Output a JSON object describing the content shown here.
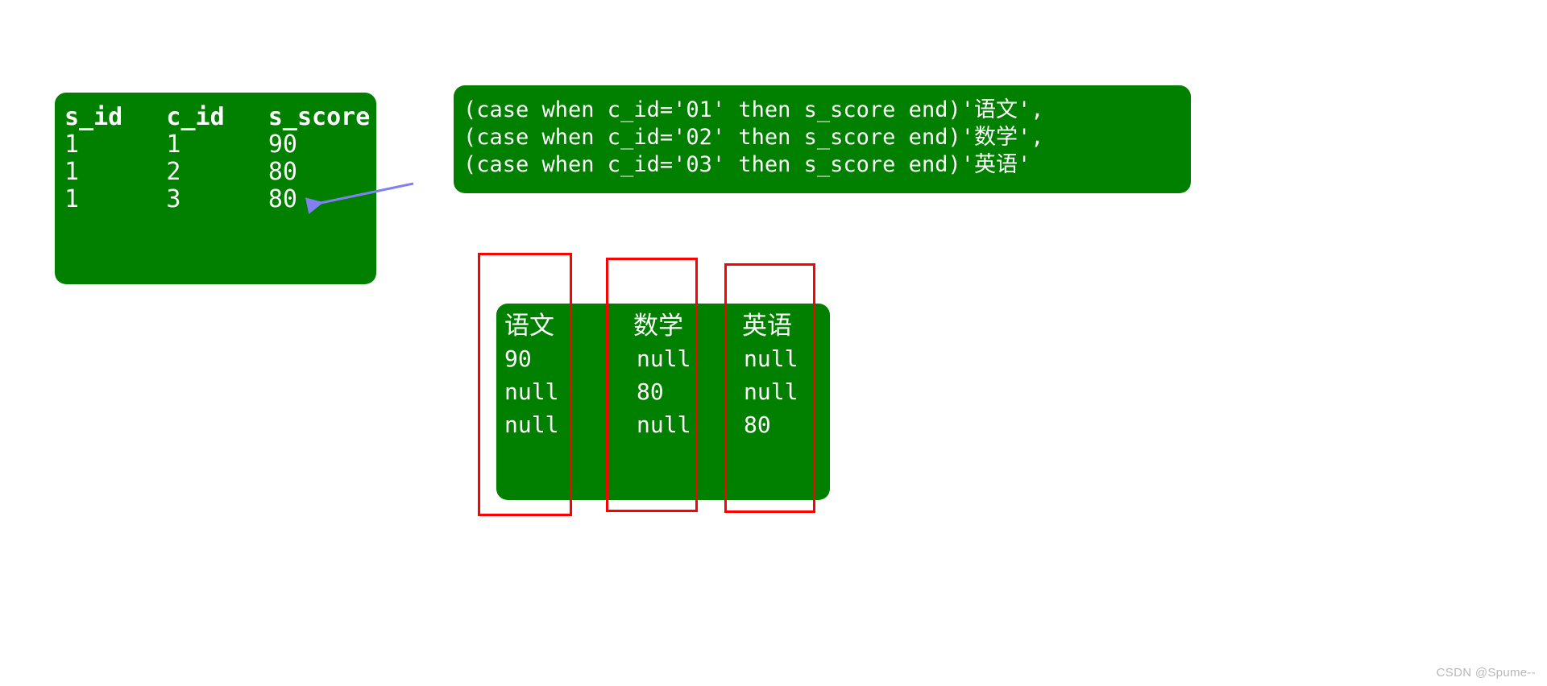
{
  "source_table": {
    "header": "s_id   c_id   s_score",
    "rows": [
      "1      1      90",
      "1      2      80",
      "1      3      80"
    ]
  },
  "sql_block": {
    "lines": [
      "(case when c_id='01' then s_score end)'语文',",
      "(case when c_id='02' then s_score end)'数学',",
      "(case when c_id='03' then s_score end)'英语'"
    ]
  },
  "result_table": {
    "columns": [
      {
        "header": "语文",
        "cells": [
          "90",
          "null",
          "null"
        ]
      },
      {
        "header": "数学",
        "cells": [
          "null",
          "80",
          "null"
        ]
      },
      {
        "header": "英语",
        "cells": [
          "null",
          "null",
          "80"
        ]
      }
    ]
  },
  "highlights": {
    "boxes": [
      {
        "label": "chinese-column-highlight"
      },
      {
        "label": "math-column-highlight"
      },
      {
        "label": "english-column-highlight"
      }
    ],
    "color": "#ff0000"
  },
  "annotation": {
    "arrow_label": "arrow-pointing-to-source-row",
    "arrow_color": "#8080f0"
  },
  "watermark": {
    "text": "CSDN @Spume--"
  },
  "colors": {
    "panel_green": "#018000",
    "text_white": "#ffffff",
    "background": "#ffffff"
  }
}
